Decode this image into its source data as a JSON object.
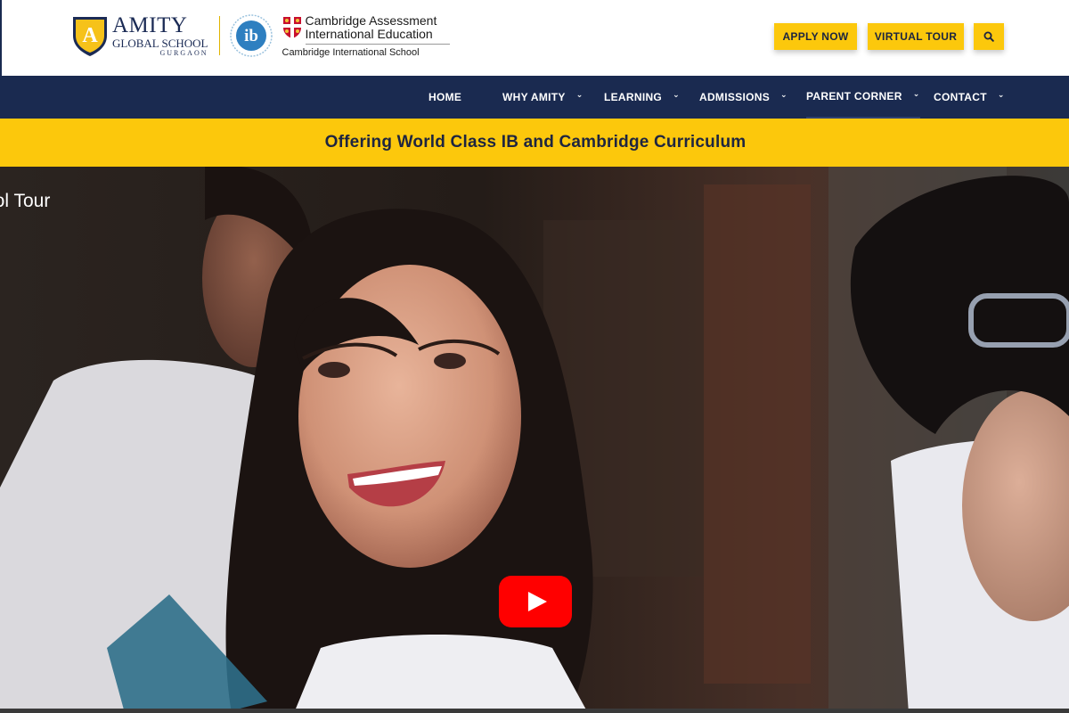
{
  "header": {
    "amity": {
      "badge_letter": "A",
      "name": "AMITY",
      "subtitle": "GLOBAL SCHOOL",
      "city": "GURGAON"
    },
    "ib_logo": {
      "icon": "ib-logo-icon",
      "text": "ib"
    },
    "cambridge": {
      "line1": "Cambridge Assessment",
      "line2": "International Education",
      "line3": "Cambridge International School"
    },
    "buttons": {
      "apply": "APPLY NOW",
      "tour": "VIRTUAL TOUR",
      "search_icon": "search-icon"
    }
  },
  "nav": {
    "items": [
      {
        "label": "HOME",
        "dropdown": false
      },
      {
        "label": "WHY AMITY",
        "dropdown": true
      },
      {
        "label": "LEARNING",
        "dropdown": true
      },
      {
        "label": "ADMISSIONS",
        "dropdown": true
      },
      {
        "label": "PARENT CORNER",
        "dropdown": true
      },
      {
        "label": "CONTACT",
        "dropdown": true
      }
    ]
  },
  "banner": {
    "text": "Offering World Class IB and Cambridge Curriculum"
  },
  "video": {
    "title": "ool Tour",
    "play_icon": "youtube-play-icon"
  },
  "colors": {
    "navy": "#1a2a50",
    "yellow": "#fcc80c",
    "youtube_red": "#ff0000"
  }
}
